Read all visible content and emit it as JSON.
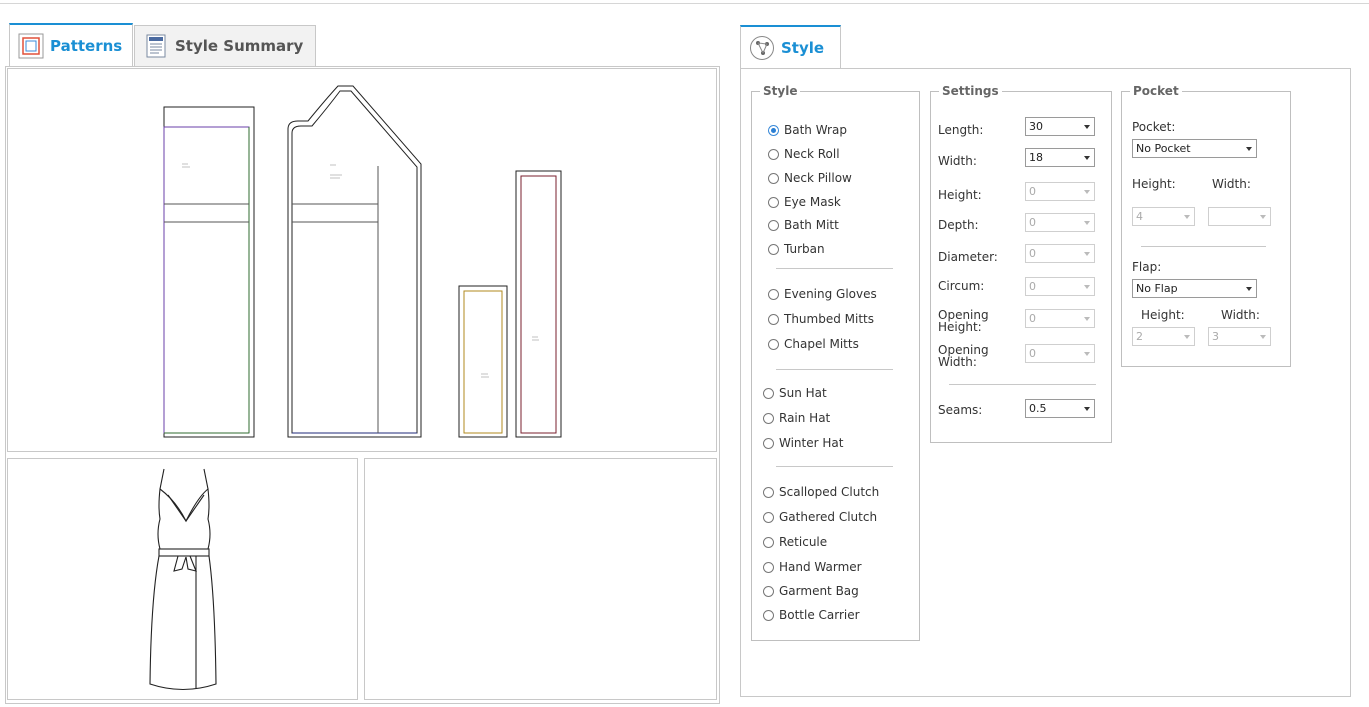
{
  "left_tabs": [
    {
      "label": "Patterns",
      "icon": "pattern-icon",
      "active": true
    },
    {
      "label": "Style Summary",
      "icon": "document-icon",
      "active": false
    }
  ],
  "right_tab": {
    "label": "Style",
    "icon": "style-icon",
    "active": true
  },
  "style_group": {
    "legend": "Style",
    "selected": "Bath Wrap",
    "sections": [
      [
        "Bath Wrap",
        "Neck Roll",
        "Neck Pillow",
        "Eye Mask",
        "Bath Mitt",
        "Turban"
      ],
      [
        "Evening Gloves",
        "Thumbed Mitts",
        "Chapel Mitts"
      ],
      [
        "Sun Hat",
        "Rain Hat",
        "Winter Hat"
      ],
      [
        "Scalloped Clutch",
        "Gathered Clutch",
        "Reticule",
        "Hand Warmer",
        "Garment Bag",
        "Bottle Carrier"
      ]
    ]
  },
  "settings_group": {
    "legend": "Settings",
    "fields": [
      {
        "label": "Length:",
        "value": "30",
        "enabled": true
      },
      {
        "label": "Width:",
        "value": "18",
        "enabled": true
      },
      {
        "label": "Height:",
        "value": "0",
        "enabled": false
      },
      {
        "label": "Depth:",
        "value": "0",
        "enabled": false
      },
      {
        "label": "Diameter:",
        "value": "0",
        "enabled": false
      },
      {
        "label": "Circum:",
        "value": "0",
        "enabled": false
      },
      {
        "label": "Opening Height:",
        "value": "0",
        "enabled": false
      },
      {
        "label": "Opening Width:",
        "value": "0",
        "enabled": false
      }
    ],
    "seams": {
      "label": "Seams:",
      "value": "0.5",
      "enabled": true
    }
  },
  "pocket_group": {
    "legend": "Pocket",
    "pocket_label": "Pocket:",
    "pocket_value": "No Pocket",
    "height_label": "Height:",
    "width_label": "Width:",
    "pocket_height": "4",
    "pocket_width": "",
    "flap_label": "Flap:",
    "flap_value": "No Flap",
    "flap_height_label": "Height:",
    "flap_width_label": "Width:",
    "flap_height": "2",
    "flap_width": "3"
  },
  "colors": {
    "accent": "#1a8fd4",
    "piece_green": "#2f6b2f",
    "piece_purple": "#6a3fa8",
    "piece_navy": "#1f2a7a",
    "piece_gold": "#b08a1e",
    "piece_maroon": "#7a1f2e"
  }
}
